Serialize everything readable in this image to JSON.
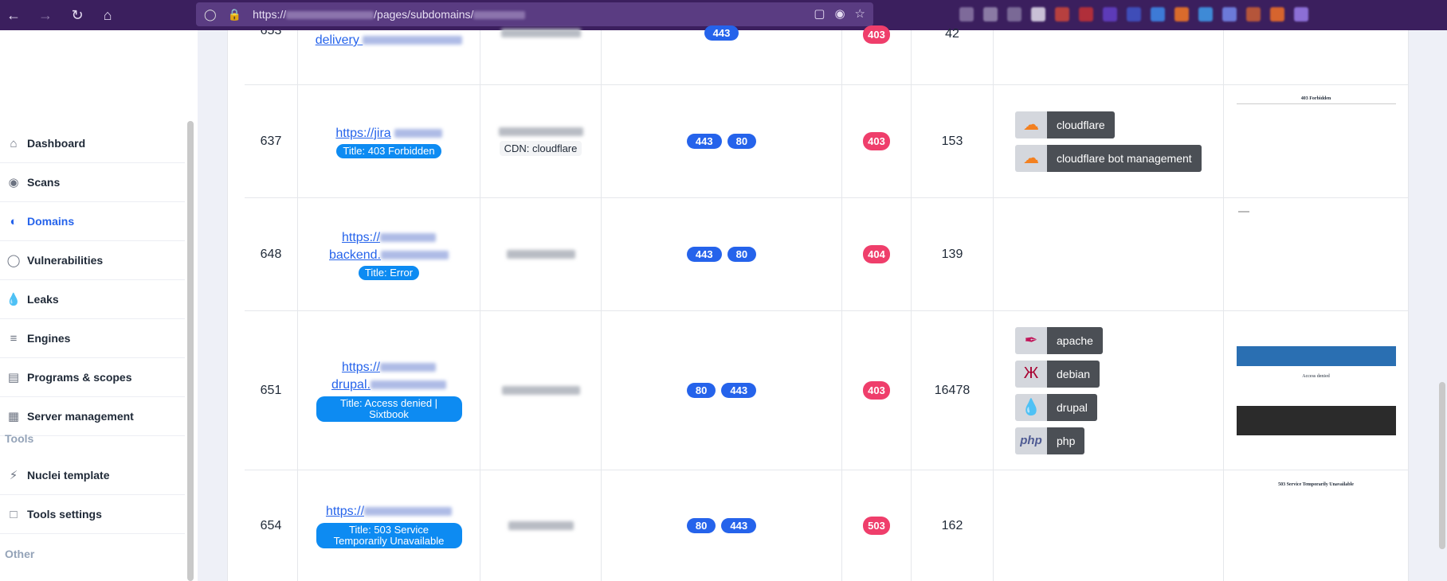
{
  "browser": {
    "url_prefix": "https://",
    "url_middle": "/pages/subdomains/"
  },
  "sidebar": {
    "items": [
      {
        "label": "Dashboard",
        "icon": "home-icon",
        "active": false
      },
      {
        "label": "Scans",
        "icon": "eye-icon",
        "active": false
      },
      {
        "label": "Domains",
        "icon": "globe-icon",
        "active": true
      },
      {
        "label": "Vulnerabilities",
        "icon": "shield-icon",
        "active": false
      },
      {
        "label": "Leaks",
        "icon": "drop-icon",
        "active": false
      },
      {
        "label": "Engines",
        "icon": "layers-icon",
        "active": false
      },
      {
        "label": "Programs & scopes",
        "icon": "book-icon",
        "active": false
      },
      {
        "label": "Server management",
        "icon": "server-icon",
        "active": false
      }
    ],
    "section_tools": "Tools",
    "tools_items": [
      {
        "label": "Nuclei template",
        "icon": "bolt-icon"
      },
      {
        "label": "Tools settings",
        "icon": "file-icon"
      }
    ],
    "section_other": "Other"
  },
  "rows": [
    {
      "id": "653",
      "url_lines": [
        "delivery"
      ],
      "title": "",
      "ip": "",
      "cdn": "",
      "ports": [
        "443"
      ],
      "status": "403",
      "size": "42",
      "tech": [],
      "shot_title": ""
    },
    {
      "id": "637",
      "url_lines": [
        "https://jira"
      ],
      "title": "Title: 403 Forbidden",
      "ip": "",
      "cdn": "CDN: cloudflare",
      "ports": [
        "443",
        "80"
      ],
      "status": "403",
      "size": "153",
      "tech": [
        {
          "name": "cloudflare",
          "icon": "cloudflare-icon"
        },
        {
          "name": "cloudflare bot management",
          "icon": "cloudflare-icon"
        }
      ],
      "shot_title": "403 Forbidden"
    },
    {
      "id": "648",
      "url_lines": [
        "https://",
        "backend."
      ],
      "title": "Title: Error",
      "ip": "",
      "cdn": "",
      "ports": [
        "443",
        "80"
      ],
      "status": "404",
      "size": "139",
      "tech": [],
      "shot_title": ""
    },
    {
      "id": "651",
      "url_lines": [
        "https://",
        "drupal."
      ],
      "title": "Title: Access denied | Sixtbook",
      "ip": "",
      "cdn": "",
      "ports": [
        "80",
        "443"
      ],
      "status": "403",
      "size": "16478",
      "tech": [
        {
          "name": "apache",
          "icon": "feather-icon"
        },
        {
          "name": "debian",
          "icon": "debian-swirl-icon"
        },
        {
          "name": "drupal",
          "icon": "drupal-drop-icon"
        },
        {
          "name": "php",
          "icon": "php-icon"
        }
      ],
      "shot_title": "Access denied"
    },
    {
      "id": "654",
      "url_lines": [
        "https://"
      ],
      "title": "Title: 503 Service Temporarily Unavailable",
      "ip": "",
      "cdn": "",
      "ports": [
        "80",
        "443"
      ],
      "status": "503",
      "size": "162",
      "tech": [],
      "shot_title": "503 Service Temporarily Unavailable"
    }
  ]
}
